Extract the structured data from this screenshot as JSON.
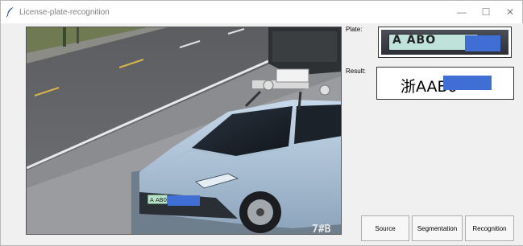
{
  "window": {
    "title": "License-plate-recognition",
    "minimize_symbol": "—",
    "maximize_symbol": "☐",
    "close_symbol": "✕"
  },
  "photo": {
    "plate_text": "A AB0",
    "corner_watermark": "7#B"
  },
  "panel": {
    "plate_label": "Plate:",
    "plate_chars": "A ABO",
    "result_label": "Result:",
    "result_text": "浙AAB0"
  },
  "buttons": {
    "source": "Source",
    "segmentation": "Segmentation",
    "recognition": "Recognition"
  },
  "colors": {
    "redaction": "#3f6fd4",
    "background": "#f0f0f0"
  }
}
